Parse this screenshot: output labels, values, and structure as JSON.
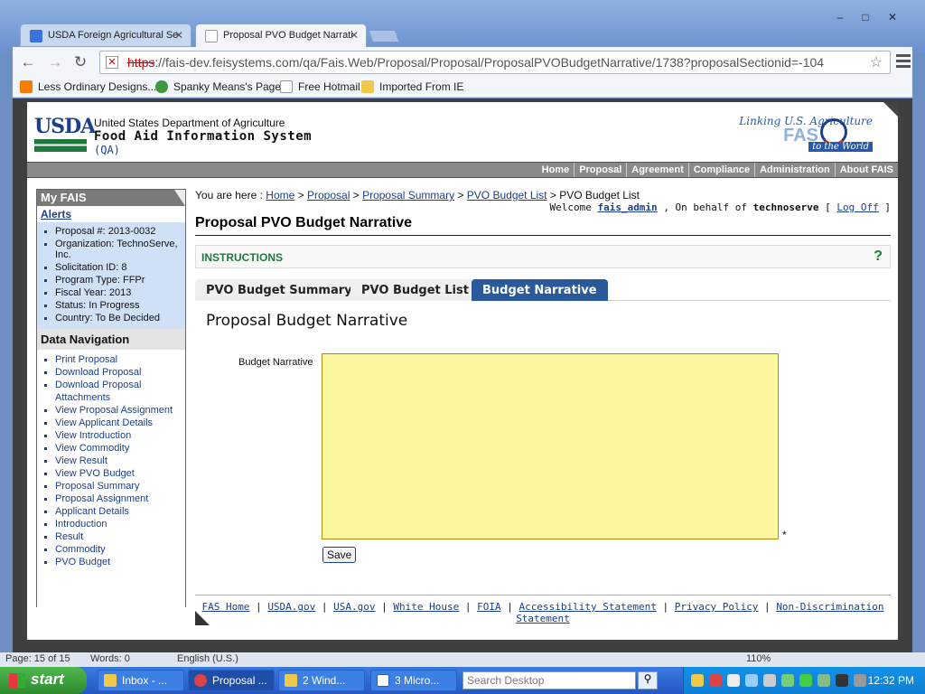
{
  "browser": {
    "tabs": [
      {
        "title": "USDA Foreign Agricultural Se",
        "active": false
      },
      {
        "title": "Proposal PVO Budget Narrati",
        "active": true
      }
    ],
    "url_scheme": "https",
    "url_rest": "://fais-dev.feisystems.com/qa/Fais.Web/Proposal/Proposal/ProposalPVOBudgetNarrative/1738?proposalSectionid=-104",
    "bookmarks": [
      "Less Ordinary Designs...",
      "Spanky Means's Page",
      "Free Hotmail",
      "Imported From IE"
    ],
    "window_buttons": [
      "–",
      "□",
      "✕"
    ]
  },
  "header": {
    "logo_text": "USDA",
    "dept": "United States Department of Agriculture",
    "system": "Food Aid Information System",
    "env": "(QA)",
    "fas_tagline": "Linking U.S. Agriculture",
    "fas_name": "FAS",
    "fas_sub": "to the World"
  },
  "topnav": [
    "Home",
    "Proposal",
    "Agreement",
    "Compliance",
    "Administration",
    "About FAIS"
  ],
  "sidebar": {
    "title": "My FAIS",
    "alerts": "Alerts",
    "info": [
      "Proposal #: 2013-0032",
      "Organization: TechnoServe, Inc.",
      "Solicitation ID: 8",
      "Program Type: FFPr",
      "Fiscal Year: 2013",
      "Status: In Progress",
      "Country: To Be Decided"
    ],
    "nav_title": "Data Navigation",
    "nav": [
      "Print Proposal",
      "Download Proposal",
      "Download Proposal Attachments",
      "View Proposal Assignment",
      "View Applicant Details",
      "View Introduction",
      "View Commodity",
      "View Result",
      "View PVO Budget",
      "Proposal Summary",
      "Proposal Assignment",
      "Applicant Details",
      "Introduction",
      "Result",
      "Commodity",
      "PVO Budget"
    ]
  },
  "breadcrumb": {
    "prefix": "You are here :",
    "links": [
      "Home",
      "Proposal",
      "Proposal Summary",
      "PVO Budget List"
    ],
    "current": "PVO Budget List"
  },
  "welcome": {
    "prefix": "Welcome",
    "user": "fais_admin",
    "mid": ", On behalf of",
    "org": "technoserve",
    "logoff": "Log Off"
  },
  "page_title": "Proposal PVO Budget Narrative",
  "instructions": {
    "label": "INSTRUCTIONS",
    "help": "?"
  },
  "tabs": [
    {
      "label": "PVO Budget Summary",
      "active": false
    },
    {
      "label": "PVO Budget List",
      "active": false
    },
    {
      "label": "Budget Narrative",
      "active": true
    }
  ],
  "form": {
    "title": "Proposal Budget Narrative",
    "label": "Budget Narrative",
    "value": "",
    "required_mark": "*",
    "save_label": "Save"
  },
  "footer": {
    "links": [
      "FAS Home",
      "USDA.gov",
      "USA.gov",
      "White House",
      "FOIA",
      "Accessibility Statement",
      "Privacy Policy",
      "Non-Discrimination Statement"
    ]
  },
  "word_status": {
    "page": "Page: 15 of 15",
    "words": "Words: 0",
    "lang": "English (U.S.)",
    "zoom": "110%"
  },
  "taskbar": {
    "start": "start",
    "items": [
      "Inbox - ...",
      "Proposal ...",
      "2 Wind...",
      "3 Micro..."
    ],
    "search_placeholder": "Search Desktop",
    "clock": "12:32 PM"
  }
}
